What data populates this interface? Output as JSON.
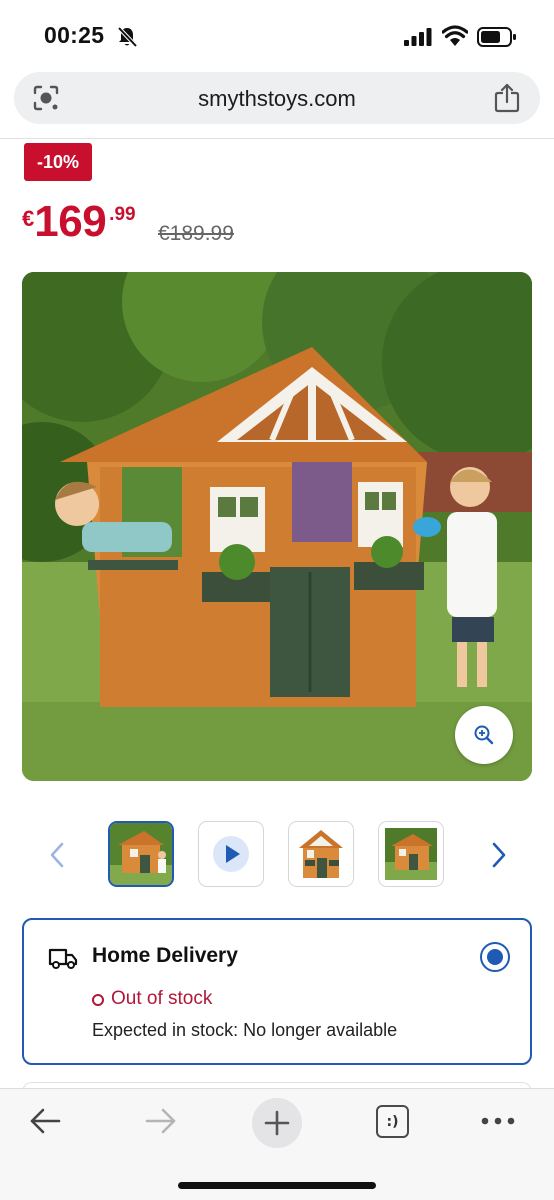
{
  "status_bar": {
    "time": "00:25",
    "icons": [
      "bell-slash-icon",
      "signal-icon",
      "wifi-icon",
      "battery-icon"
    ]
  },
  "browser": {
    "url": "smythstoys.com",
    "left_icon": "lens-icon",
    "right_icon": "share-icon"
  },
  "product": {
    "discount_badge": "-10%",
    "price_currency": "€",
    "price_main": "169",
    "price_cents": ".99",
    "old_price": "€189.99",
    "image_icon": "zoom-in-icon"
  },
  "thumbnails": {
    "prev_icon": "chevron-left-icon",
    "next_icon": "chevron-right-icon",
    "items": [
      {
        "type": "image",
        "selected": true
      },
      {
        "type": "video",
        "icon": "play-icon",
        "selected": false
      },
      {
        "type": "image",
        "selected": false
      },
      {
        "type": "image",
        "selected": false
      }
    ]
  },
  "delivery": {
    "icon": "truck-icon",
    "title": "Home Delivery",
    "selected": true,
    "stock_status": "Out of stock",
    "expected": "Expected in stock: No longer available"
  },
  "toolbar": {
    "back_icon": "arrow-left-icon",
    "forward_icon": "arrow-right-icon",
    "new_tab_icon": "plus-icon",
    "tabs_label": ":)",
    "more_icon": "more-dots-icon"
  },
  "colors": {
    "accent_red": "#c8102e",
    "accent_blue": "#1f5bb4",
    "stock_red": "#b0183a"
  }
}
